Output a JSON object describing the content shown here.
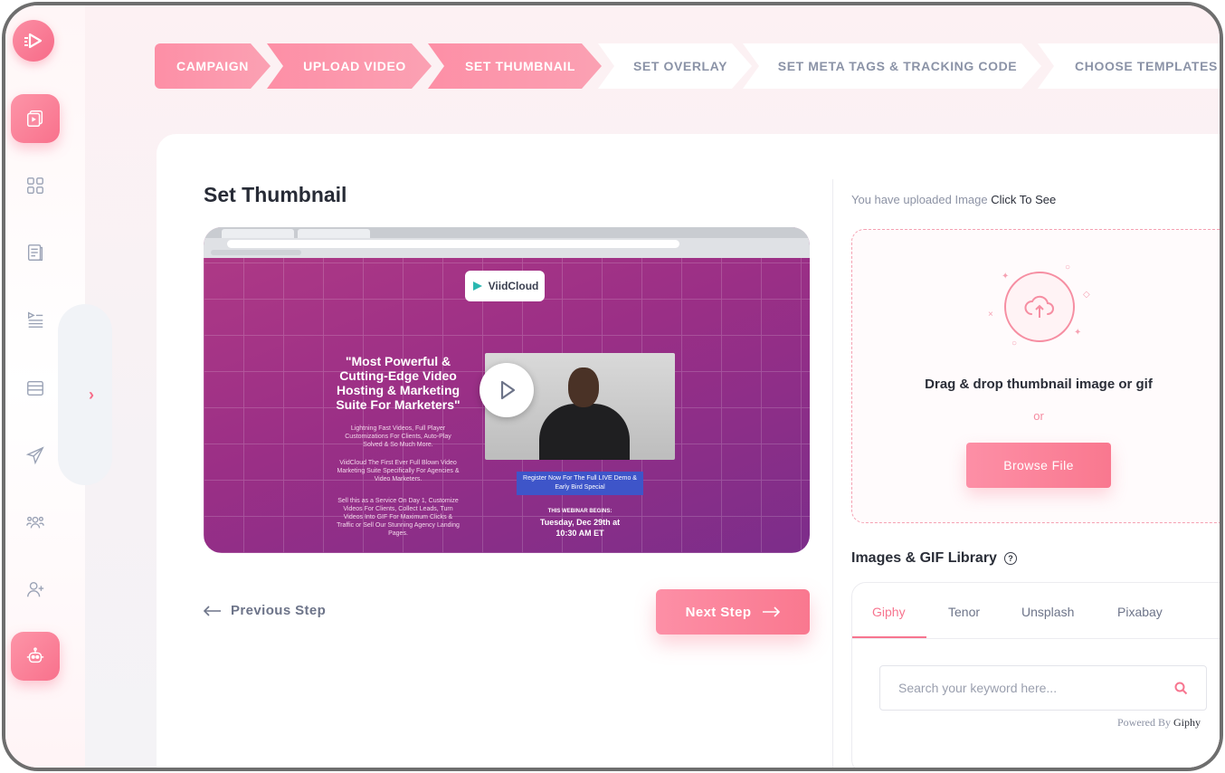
{
  "stepper": {
    "steps": [
      {
        "label": "CAMPAIGN",
        "state": "done"
      },
      {
        "label": "UPLOAD VIDEO",
        "state": "done"
      },
      {
        "label": "SET THUMBNAIL",
        "state": "active"
      },
      {
        "label": "SET OVERLAY",
        "state": "todo"
      },
      {
        "label": "SET META TAGS & TRACKING CODE",
        "state": "todo"
      },
      {
        "label": "CHOOSE TEMPLATES",
        "state": "todo"
      }
    ]
  },
  "sidebar": {
    "items": [
      {
        "icon": "video-library-icon",
        "active": true
      },
      {
        "icon": "dashboard-grid-icon",
        "active": false
      },
      {
        "icon": "document-icon",
        "active": false
      },
      {
        "icon": "playlist-icon",
        "active": false
      },
      {
        "icon": "stack-icon",
        "active": false
      },
      {
        "icon": "send-icon",
        "active": false
      },
      {
        "icon": "team-icon",
        "active": false
      },
      {
        "icon": "add-user-icon",
        "active": false
      },
      {
        "icon": "robot-icon",
        "active": true
      }
    ]
  },
  "main": {
    "title": "Set Thumbnail",
    "video": {
      "brand": "ViidCloud",
      "headline": "\"Most Powerful & Cutting-Edge Video Hosting & Marketing Suite For Marketers\"",
      "copy1": "Lightning Fast Videos, Full Player Customizations For Clients, Auto-Play Solved & So Much More.",
      "copy2": "ViidCloud The First Ever Full Blown Video Marketing Suite Specifically For Agencies & Video Marketers.",
      "copy3": "Sell this as a Service On Day 1, Customize Videos For Clients, Collect Leads, Turn Videos Into GIF For Maximum Clicks & Traffic or Sell Our Stunning Agency Landing Pages.",
      "register": "Register Now For The Full LIVE Demo & Early Bird Special",
      "date_label": "THIS WEBINAR BEGINS:",
      "date_value": "Tuesday, Dec 29th at 10:30 AM ET"
    },
    "prev_label": "Previous Step",
    "next_label": "Next Step"
  },
  "upload": {
    "note": "You have uploaded Image",
    "note_link": "Click To See",
    "drop_text": "Drag & drop thumbnail image or gif",
    "or_text": "or",
    "browse_label": "Browse File"
  },
  "library": {
    "title": "Images & GIF Library",
    "tabs": [
      "Giphy",
      "Tenor",
      "Unsplash",
      "Pixabay"
    ],
    "active_tab": "Giphy",
    "search_placeholder": "Search your keyword here...",
    "powered_by": "Powered By",
    "powered_brand": "Giphy"
  },
  "colors": {
    "accent": "#f7758f",
    "accent_light": "#fd8fa6",
    "text_dark": "#2a2e38",
    "text_muted": "#8d93a5"
  }
}
